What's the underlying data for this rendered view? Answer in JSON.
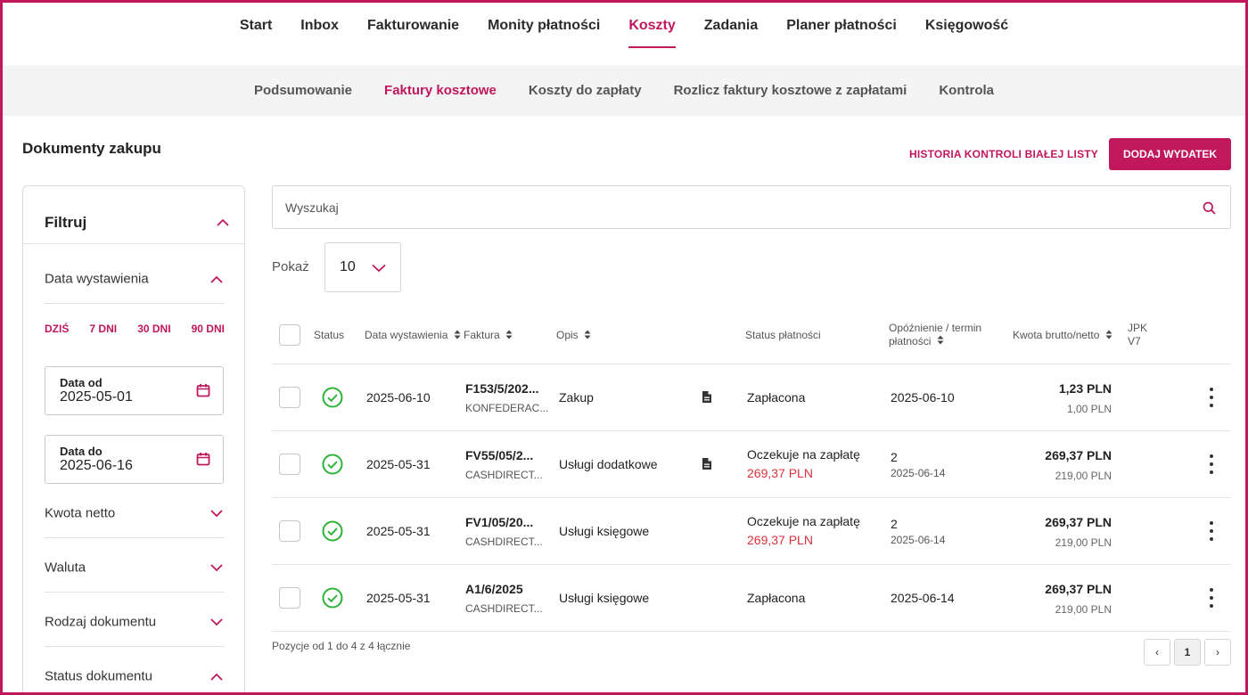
{
  "top_nav": [
    "Start",
    "Inbox",
    "Fakturowanie",
    "Monity płatności",
    "Koszty",
    "Zadania",
    "Planer płatności",
    "Księgowość"
  ],
  "top_nav_active": "Koszty",
  "sub_nav": [
    "Podsumowanie",
    "Faktury kosztowe",
    "Koszty do zapłaty",
    "Rozlicz faktury kosztowe z zapłatami",
    "Kontrola"
  ],
  "sub_nav_active": "Faktury kosztowe",
  "page_title": "Dokumenty zakupu",
  "history_link": "HISTORIA KONTROLI BIAŁEJ LISTY",
  "add_button": "DODAJ WYDATEK",
  "filter": {
    "title": "Filtruj",
    "issue_date": "Data wystawienia",
    "quick_ranges": [
      "DZIŚ",
      "7 DNI",
      "30 DNI",
      "90 DNI"
    ],
    "date_from": {
      "label": "Data od",
      "value": "2025-05-01"
    },
    "date_to": {
      "label": "Data do",
      "value": "2025-06-16"
    },
    "sections": [
      "Kwota netto",
      "Waluta",
      "Rodzaj dokumentu",
      "Status dokumentu"
    ]
  },
  "search": {
    "placeholder": "Wyszukaj"
  },
  "show": {
    "label": "Pokaż",
    "value": "10"
  },
  "columns": {
    "status": "Status",
    "issue_date": "Data wystawienia",
    "invoice": "Faktura",
    "description": "Opis",
    "payment_status": "Status płatności",
    "delay_line1": "Opóźnienie / termin",
    "delay_line2": "płatności",
    "amount": "Kwota brutto/netto",
    "jpk_line1": "JPK",
    "jpk_line2": "V7"
  },
  "rows": [
    {
      "date": "2025-06-10",
      "invoice": "F153/5/202...",
      "contractor": "KONFEDERAC...",
      "description": "Zakup",
      "has_doc": true,
      "payment_status": "Zapłacona",
      "payment_amount": "",
      "delay": "",
      "due": "2025-06-10",
      "gross": "1,23 PLN",
      "net": "1,00 PLN"
    },
    {
      "date": "2025-05-31",
      "invoice": "FV55/05/2...",
      "contractor": "CASHDIRECT...",
      "description": "Usługi dodatkowe",
      "has_doc": true,
      "payment_status": "Oczekuje na zapłatę",
      "payment_amount": "269,37 PLN",
      "delay": "2",
      "due": "2025-06-14",
      "gross": "269,37 PLN",
      "net": "219,00 PLN"
    },
    {
      "date": "2025-05-31",
      "invoice": "FV1/05/20...",
      "contractor": "CASHDIRECT...",
      "description": "Usługi księgowe",
      "has_doc": false,
      "payment_status": "Oczekuje na zapłatę",
      "payment_amount": "269,37 PLN",
      "delay": "2",
      "due": "2025-06-14",
      "gross": "269,37 PLN",
      "net": "219,00 PLN"
    },
    {
      "date": "2025-05-31",
      "invoice": "A1/6/2025",
      "contractor": "CASHDIRECT...",
      "description": "Usługi księgowe",
      "has_doc": false,
      "payment_status": "Zapłacona",
      "payment_amount": "",
      "delay": "",
      "due": "2025-06-14",
      "gross": "269,37 PLN",
      "net": "219,00 PLN"
    }
  ],
  "pagination": {
    "info": "Pozycje od 1 do 4 z 4 łącznie",
    "prev": "‹",
    "current": "1",
    "next": "›"
  },
  "colors": {
    "accent": "#c0175d",
    "success": "#2eb33b",
    "danger": "#d8323c"
  },
  "icons": [
    "chevron-up-icon",
    "chevron-down-icon",
    "calendar-icon",
    "search-icon",
    "sort-icon",
    "check-circle-icon",
    "document-icon",
    "kebab-menu-icon"
  ]
}
